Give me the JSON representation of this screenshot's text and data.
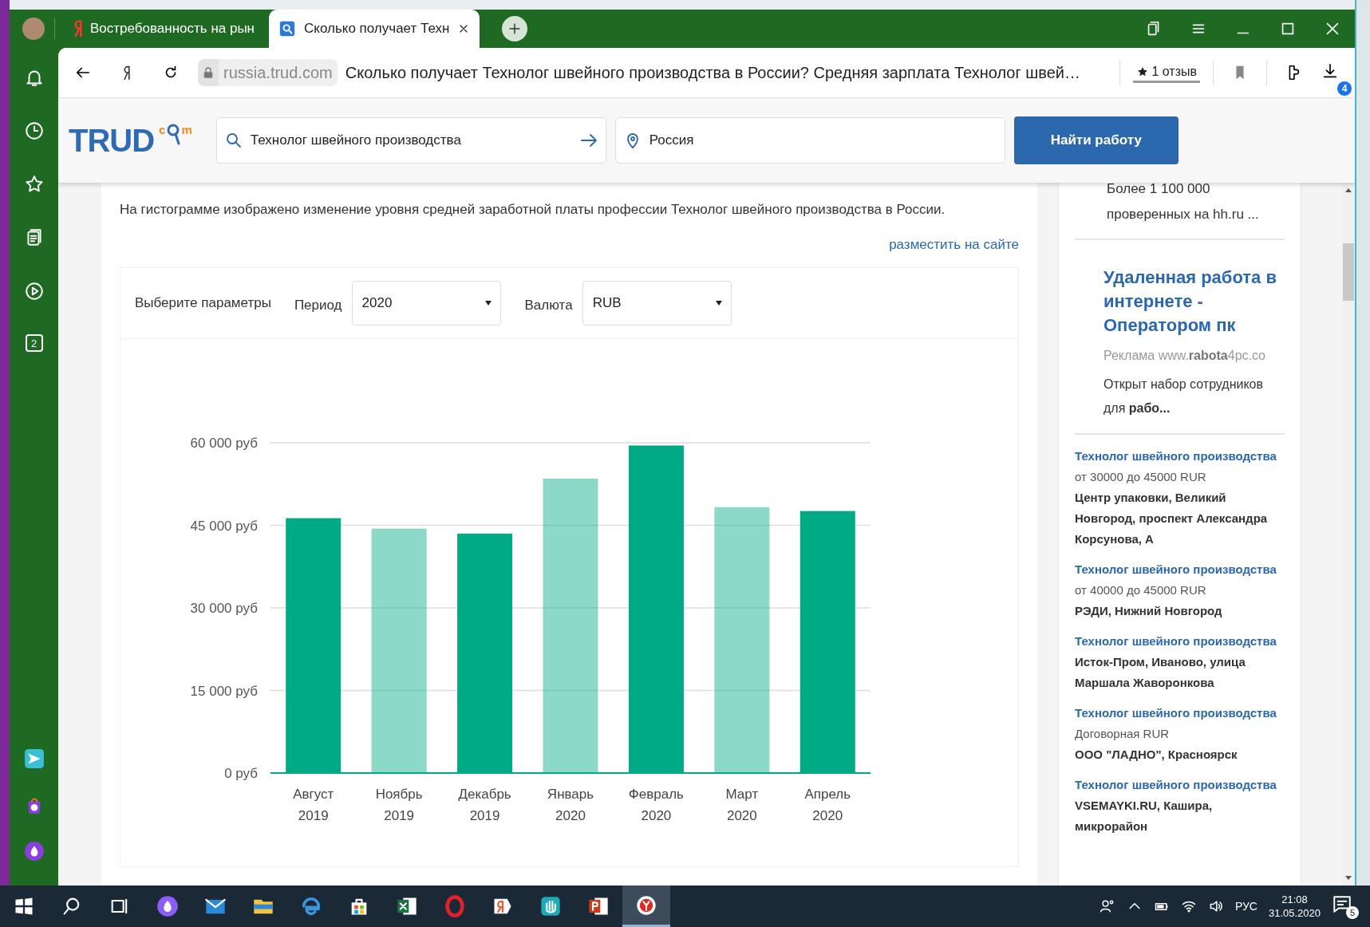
{
  "browser": {
    "tabs": [
      {
        "kind": "yandex",
        "title": "Востребованность на рын",
        "selected": false
      },
      {
        "kind": "search",
        "title": "Сколько получает Техн",
        "selected": true
      }
    ],
    "address_bar": {
      "url": "russia.trud.com",
      "page_title": "Сколько получает Технолог швейного производства в России? Средняя зарплата Технолог швей…",
      "reviews": "1 отзыв",
      "downloads_badge": "4"
    },
    "sidebar": {
      "top": [
        {
          "kind": "bell"
        },
        {
          "kind": "clock"
        },
        {
          "kind": "star"
        },
        {
          "kind": "collections"
        },
        {
          "kind": "play"
        },
        {
          "kind": "count",
          "label": "2"
        }
      ],
      "bottom": [
        {
          "kind": "send"
        },
        {
          "kind": "alice-bag"
        },
        {
          "kind": "alice"
        }
      ]
    }
  },
  "site_header": {
    "logo": {
      "main": "TRUD",
      "left": "c",
      "right": "m"
    },
    "search": {
      "value": "Технолог швейного производства"
    },
    "location": {
      "value": "Россия"
    },
    "button": "Найти работу"
  },
  "content": {
    "description": "На гистограмме изображено изменение уровня средней заработной платы профессии Технолог швейного производства в России.",
    "embed_link": "разместить на сайте",
    "params": {
      "label": "Выберите параметры",
      "period": {
        "label": "Период",
        "value": "2020"
      },
      "currency": {
        "label": "Валюта",
        "value": "RUB"
      }
    },
    "chart_data": {
      "type": "bar",
      "categories": [
        "Август 2019",
        "Ноябрь 2019",
        "Декабрь 2019",
        "Январь 2020",
        "Февраль 2020",
        "Март 2020",
        "Апрель 2020"
      ],
      "grid": true,
      "series": [
        {
          "color": "#00aa84",
          "values": [
            46300,
            44400,
            43500,
            53500,
            59500,
            48300,
            47600
          ]
        }
      ],
      "ylim": [
        0,
        60000
      ],
      "yticks": [
        {
          "value": 0,
          "label": "0 руб"
        },
        {
          "value": 15000,
          "label": "15 000 руб"
        },
        {
          "value": 30000,
          "label": "30 000 руб"
        },
        {
          "value": 45000,
          "label": "45 000 руб"
        },
        {
          "value": 60000,
          "label": "60 000 руб"
        }
      ]
    }
  },
  "right_sidebar": {
    "ad_tail": "Более 1 100 000 проверенных на hh.ru ...",
    "ad": {
      "title": "Удаленная работа в интернете - Оператором пк",
      "source": "Реклама www.**rabota**4pc.co",
      "text": "Открыт набор сотрудников для **рабо...**"
    },
    "jobs": [
      {
        "title": "Технолог швейного производства",
        "salary": "от 30000 до 45000 RUR",
        "company": "Центр упаковки, Великий Новгород, проспект Александра Корсунова, А"
      },
      {
        "title": "Технолог швейного производства",
        "salary": "от 40000 до 45000 RUR",
        "company": "РЭДИ, Нижний Новгород"
      },
      {
        "title": "Технолог швейного производства",
        "company": "Исток-Пром, Иваново, улица Маршала Жаворонкова"
      },
      {
        "title": "Технолог швейного производства",
        "salary": "Договорная RUR",
        "company": "ООО \"ЛАДНО\", Красноярск"
      },
      {
        "title": "Технолог швейного производства",
        "company": "VSEMAYKI.RU, Кашира, микрорайон"
      }
    ]
  },
  "taskbar": {
    "apps": [
      {
        "kind": "start",
        "selected": false
      },
      {
        "kind": "search",
        "selected": false
      },
      {
        "kind": "task-view",
        "selected": false
      },
      {
        "kind": "alice",
        "selected": false
      },
      {
        "kind": "mail",
        "selected": false
      },
      {
        "kind": "folder",
        "selected": false
      },
      {
        "kind": "edge",
        "selected": false
      },
      {
        "kind": "store",
        "selected": false
      },
      {
        "kind": "excel",
        "selected": false
      },
      {
        "kind": "opera",
        "selected": false
      },
      {
        "kind": "yandex",
        "selected": false
      },
      {
        "kind": "hand",
        "selected": false
      },
      {
        "kind": "powerpoint",
        "selected": false
      },
      {
        "kind": "ybrowser",
        "selected": true
      }
    ],
    "tray": {
      "language": "РУС",
      "time": "21:08",
      "date": "31.05.2020",
      "notifications": "5"
    }
  }
}
